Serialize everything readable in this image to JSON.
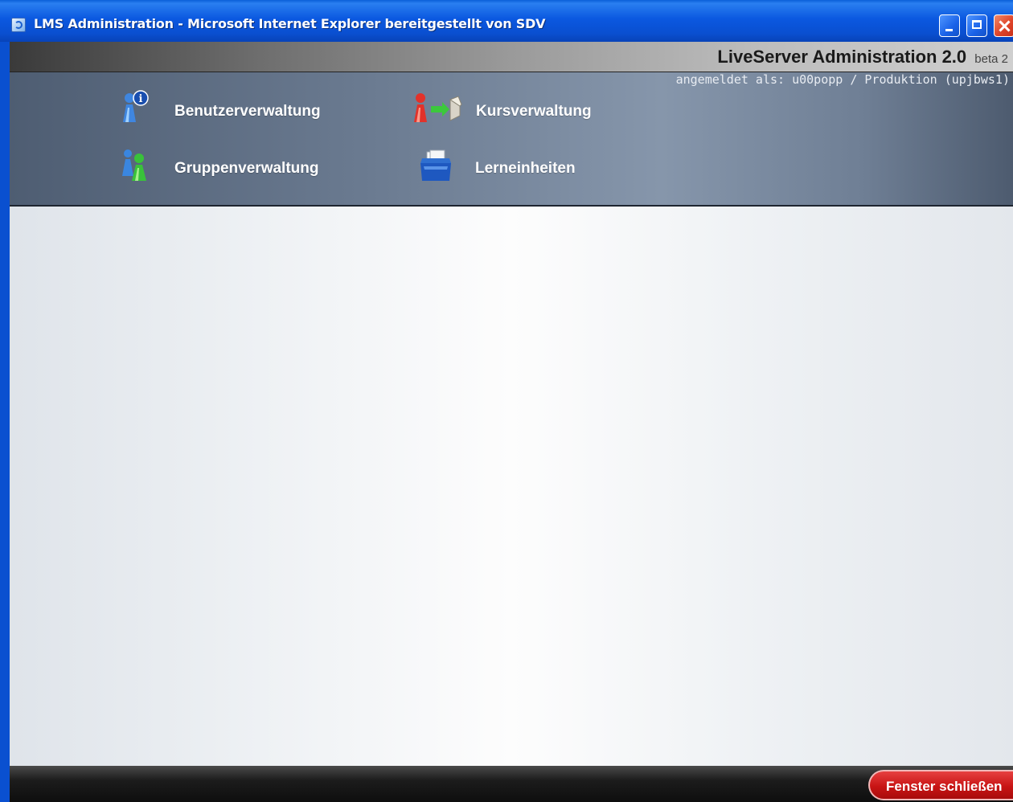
{
  "window": {
    "title": "LMS Administration - Microsoft Internet Explorer bereitgestellt von SDV",
    "minimize_label": "",
    "maximize_label": "",
    "close_label": ""
  },
  "app": {
    "title": "LiveServer Administration 2.0",
    "version_tag": "beta 2",
    "login_status": "angemeldet als: u00popp / Produktion (upjbws1)"
  },
  "nav": {
    "items": [
      {
        "label": "Benutzerverwaltung",
        "icon": "user-info-icon"
      },
      {
        "label": "Kursverwaltung",
        "icon": "course-icon"
      },
      {
        "label": "Gruppenverwaltung",
        "icon": "group-icon"
      },
      {
        "label": "Lerneinheiten",
        "icon": "learning-units-icon"
      }
    ]
  },
  "footer": {
    "close_window_label": "Fenster schließen"
  },
  "colors": {
    "titlebar_blue": "#0b58e0",
    "header_slate": "#6a7a90",
    "close_red": "#c81414"
  }
}
